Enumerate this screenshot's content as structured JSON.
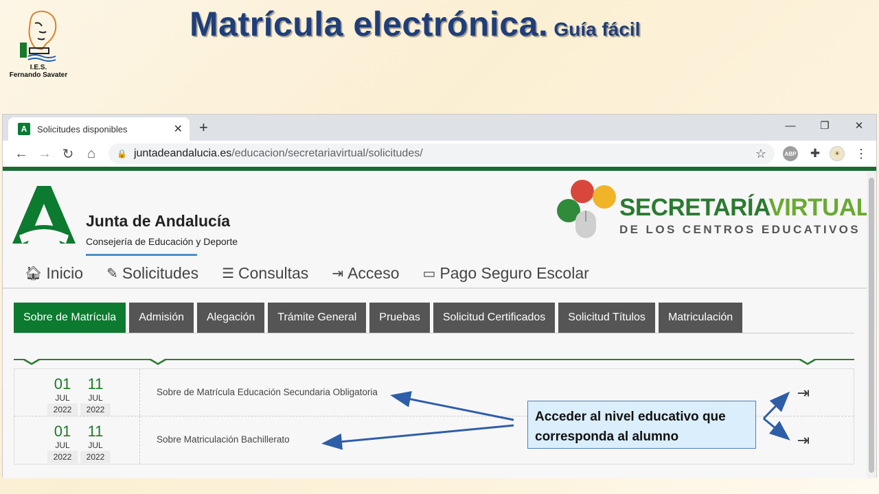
{
  "slide": {
    "title_main": "Matrícula electrónica.",
    "title_sub": "Guía fácil",
    "school_line1": "I.E.S.",
    "school_line2": "Fernando Savater"
  },
  "browser": {
    "tab_title": "Solicitudes disponibles",
    "tab_icon": "A",
    "url_host": "juntadeandalucia.es",
    "url_path": "/educacion/secretariavirtual/solicitudes/",
    "ext_abp": "ABP"
  },
  "site": {
    "org_name": "Junta de Andalucía",
    "org_sub": "Consejería de Educación y Deporte",
    "sv_title_a": "SECRETARÍA",
    "sv_title_b": "VIRTUAL",
    "sv_subtitle": "DE LOS CENTROS EDUCATIVOS",
    "nav": [
      {
        "label": "Inicio",
        "icon": "home-icon"
      },
      {
        "label": "Solicitudes",
        "icon": "pencil-icon"
      },
      {
        "label": "Consultas",
        "icon": "list-icon"
      },
      {
        "label": "Acceso",
        "icon": "sign-in-icon"
      },
      {
        "label": "Pago Seguro Escolar",
        "icon": "credit-card-icon"
      }
    ],
    "subtabs": [
      "Sobre de Matrícula",
      "Admisión",
      "Alegación",
      "Trámite General",
      "Pruebas",
      "Solicitud Certificados",
      "Solicitud Títulos",
      "Matriculación"
    ],
    "rows": [
      {
        "start": {
          "day": "01",
          "month": "JUL",
          "year": "2022"
        },
        "end": {
          "day": "11",
          "month": "JUL",
          "year": "2022"
        },
        "title": "Sobre de Matrícula Educación Secundaria Obligatoria"
      },
      {
        "start": {
          "day": "01",
          "month": "JUL",
          "year": "2022"
        },
        "end": {
          "day": "11",
          "month": "JUL",
          "year": "2022"
        },
        "title": "Sobre Matriculación Bachillerato"
      }
    ]
  },
  "callout": {
    "line1": "Acceder al nivel educativo que",
    "line2": "corresponda al alumno"
  },
  "colors": {
    "title_blue": "#1f3e7a",
    "junta_green": "#0c7a2f",
    "tab_gray": "#555555",
    "arrow_blue": "#2f5ea8"
  }
}
